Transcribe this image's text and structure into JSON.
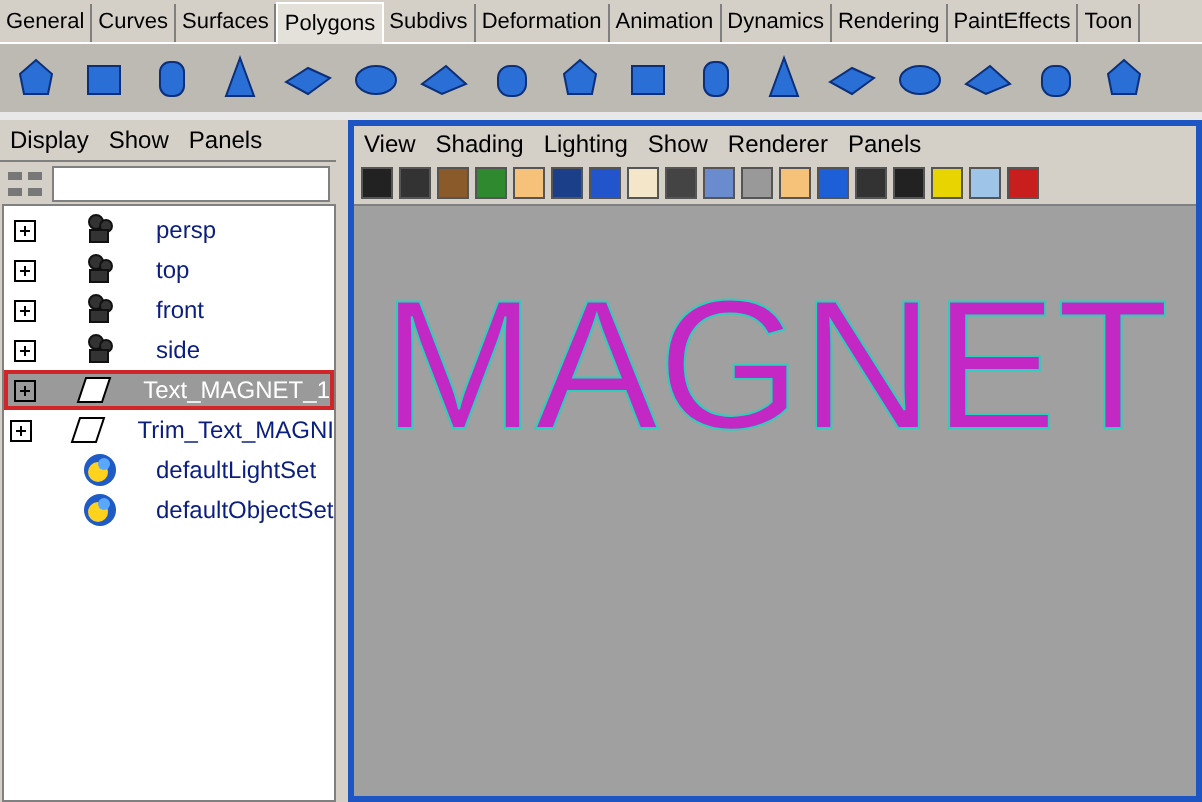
{
  "shelf_tabs": [
    {
      "label": "General",
      "selected": false
    },
    {
      "label": "Curves",
      "selected": false
    },
    {
      "label": "Surfaces",
      "selected": false
    },
    {
      "label": "Polygons",
      "selected": true
    },
    {
      "label": "Subdivs",
      "selected": false
    },
    {
      "label": "Deformation",
      "selected": false
    },
    {
      "label": "Animation",
      "selected": false
    },
    {
      "label": "Dynamics",
      "selected": false
    },
    {
      "label": "Rendering",
      "selected": false
    },
    {
      "label": "PaintEffects",
      "selected": false
    },
    {
      "label": "Toon",
      "selected": false
    }
  ],
  "outliner": {
    "menu": [
      "Display",
      "Show",
      "Panels"
    ],
    "items": [
      {
        "label": "persp",
        "kind": "camera",
        "expandable": true,
        "selected": false
      },
      {
        "label": "top",
        "kind": "camera",
        "expandable": true,
        "selected": false
      },
      {
        "label": "front",
        "kind": "camera",
        "expandable": true,
        "selected": false
      },
      {
        "label": "side",
        "kind": "camera",
        "expandable": true,
        "selected": false
      },
      {
        "label": "Text_MAGNET_1",
        "kind": "shape",
        "expandable": true,
        "selected": true
      },
      {
        "label": "Trim_Text_MAGNI",
        "kind": "shape",
        "expandable": true,
        "selected": false
      },
      {
        "label": "defaultLightSet",
        "kind": "set",
        "expandable": false,
        "selected": false
      },
      {
        "label": "defaultObjectSet",
        "kind": "set",
        "expandable": false,
        "selected": false
      }
    ]
  },
  "viewport": {
    "menu": [
      "View",
      "Shading",
      "Lighting",
      "Show",
      "Renderer",
      "Panels"
    ],
    "model_text": "MAGNET"
  }
}
